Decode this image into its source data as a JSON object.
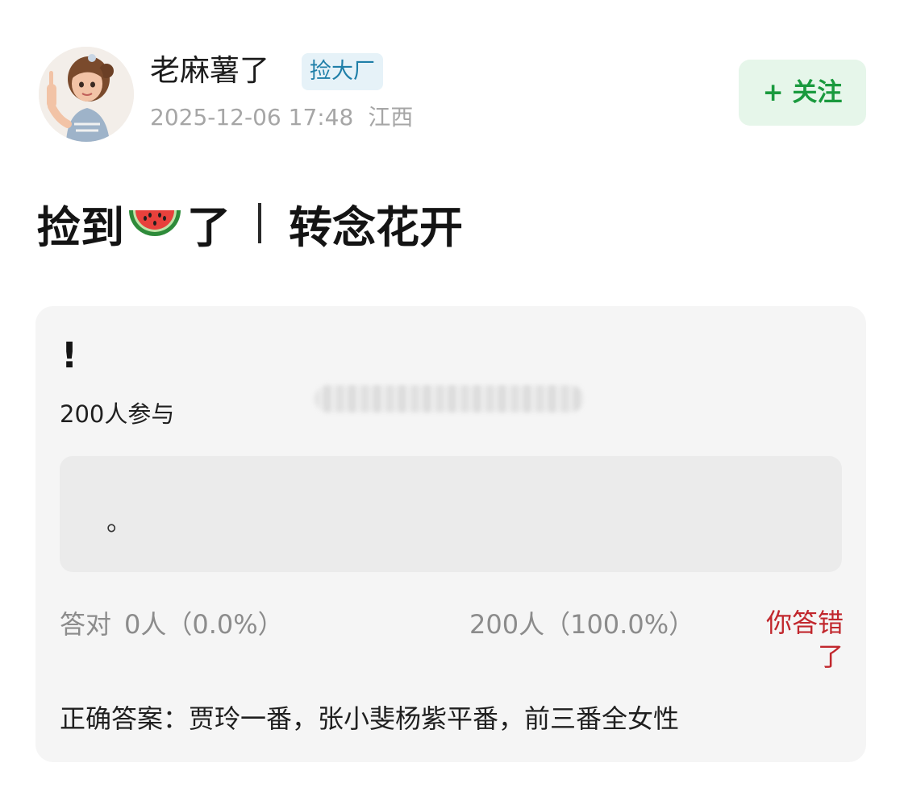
{
  "header": {
    "username": "老麻薯了",
    "badge": "捡大厂",
    "timestamp": "2025-12-06 17:48",
    "location": "江西",
    "follow_label": "+ 关注",
    "avatar_icon": "avatar-icon"
  },
  "post": {
    "title_prefix": "捡到",
    "title_emoji_icon": "watermelon-icon",
    "title_suffix": "了",
    "title_tail": "转念花开"
  },
  "quiz": {
    "question": "!",
    "participants": "200人参与",
    "option_text": "。",
    "correct_label": "答对",
    "correct_stat": "0人（0.0%）",
    "wrong_stat": "200人（100.0%）",
    "result_tag": "你答错了",
    "answer": "正确答案：贾玲一番，张小斐杨紫平番，前三番全女性"
  },
  "colors": {
    "follow_text": "#1a9a3e",
    "follow_bg": "#e6f6ea",
    "badge_text": "#1f7fa8",
    "badge_bg": "#e6f2f8",
    "wrong_text": "#c1272d",
    "card_bg": "#f5f5f5"
  }
}
